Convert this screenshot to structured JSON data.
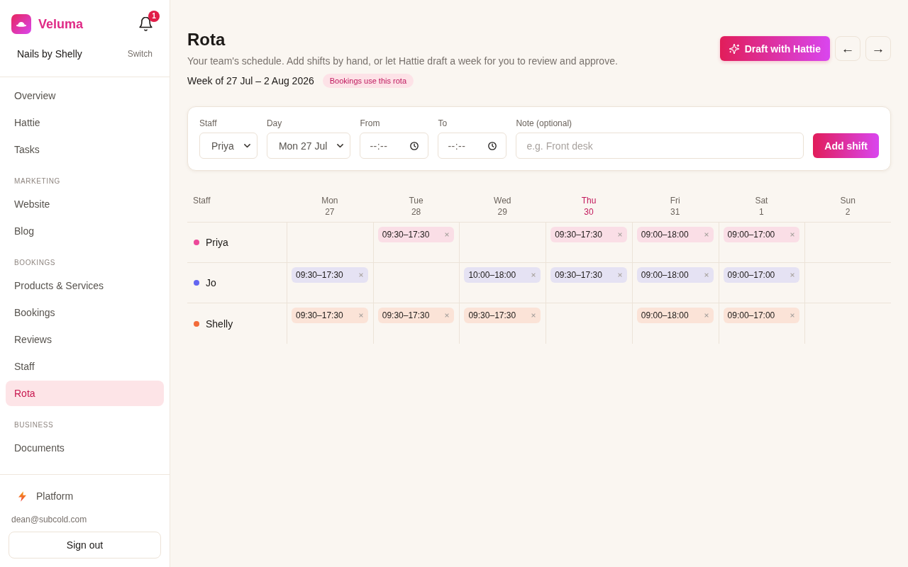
{
  "sidebar": {
    "brand": "Veluma",
    "notification_count": "1",
    "workspace": {
      "name": "Nails by Shelly",
      "action": "Switch"
    },
    "nav": [
      {
        "kind": "item",
        "label": "Overview",
        "selected": false
      },
      {
        "kind": "item",
        "label": "Hattie",
        "selected": false
      },
      {
        "kind": "item",
        "label": "Tasks",
        "selected": false
      },
      {
        "kind": "section",
        "label": "MARKETING"
      },
      {
        "kind": "item",
        "label": "Website",
        "selected": false
      },
      {
        "kind": "item",
        "label": "Blog",
        "selected": false
      },
      {
        "kind": "section",
        "label": "BOOKINGS"
      },
      {
        "kind": "item",
        "label": "Products & Services",
        "selected": false
      },
      {
        "kind": "item",
        "label": "Bookings",
        "selected": false
      },
      {
        "kind": "item",
        "label": "Reviews",
        "selected": false
      },
      {
        "kind": "item",
        "label": "Staff",
        "selected": false
      },
      {
        "kind": "item",
        "label": "Rota",
        "selected": true
      },
      {
        "kind": "section",
        "label": "BUSINESS"
      },
      {
        "kind": "item",
        "label": "Documents",
        "selected": false
      }
    ],
    "footer": {
      "platform": "Platform",
      "email": "dean@subcold.com",
      "sign_out": "Sign out"
    }
  },
  "header": {
    "title": "Rota",
    "subtitle": "Your team's schedule. Add shifts by hand, or let Hattie draft a week for you to review and approve.",
    "week": "Week of 27 Jul – 2 Aug 2026",
    "badge": "Bookings use this rota",
    "draft_button": "Draft with Hattie",
    "prev_button": "←",
    "next_button": "→"
  },
  "shift_form": {
    "fields": [
      {
        "kind": "select",
        "label": "Staff",
        "value": "Priya"
      },
      {
        "kind": "select",
        "label": "Day",
        "value": "Mon 27 Jul"
      },
      {
        "kind": "time",
        "label": "From",
        "placeholder": "--:--"
      },
      {
        "kind": "time",
        "label": "To",
        "placeholder": "--:--"
      },
      {
        "kind": "text",
        "label": "Note (optional)",
        "placeholder": "e.g. Front desk"
      }
    ],
    "submit": "Add shift"
  },
  "rota": {
    "staff_heading": "Staff",
    "days": [
      {
        "name": "Mon",
        "date": "27",
        "today": false
      },
      {
        "name": "Tue",
        "date": "28",
        "today": false
      },
      {
        "name": "Wed",
        "date": "29",
        "today": false
      },
      {
        "name": "Thu",
        "date": "30",
        "today": true
      },
      {
        "name": "Fri",
        "date": "31",
        "today": false
      },
      {
        "name": "Sat",
        "date": "1",
        "today": false
      },
      {
        "name": "Sun",
        "date": "2",
        "today": false
      }
    ],
    "rows": [
      {
        "name": "Priya",
        "color": "#ec4899",
        "cells": [
          null,
          "09:30–17:30",
          null,
          "09:30–17:30",
          "09:00–18:00",
          "09:00–17:00",
          null
        ]
      },
      {
        "name": "Jo",
        "color": "#6366f1",
        "cells": [
          "09:30–17:30",
          null,
          "10:00–18:00",
          "09:30–17:30",
          "09:00–18:00",
          "09:00–17:00",
          null
        ]
      },
      {
        "name": "Shelly",
        "color": "#f26b3a",
        "cells": [
          "09:30–17:30",
          "09:30–17:30",
          "09:30–17:30",
          null,
          "09:00–18:00",
          "09:00–17:00",
          null
        ]
      }
    ]
  }
}
